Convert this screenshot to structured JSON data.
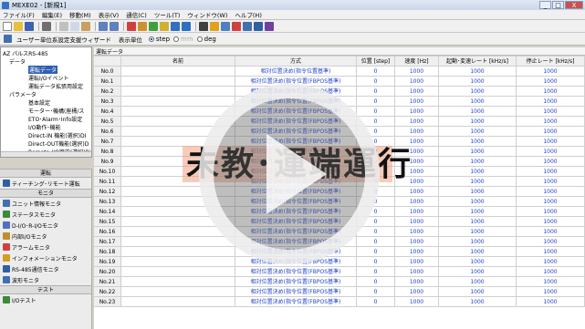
{
  "window": {
    "title": "MEXE02 - [新規1]",
    "min": "_",
    "max": "□",
    "close": "X"
  },
  "menu": [
    "ファイル(F)",
    "編集(E)",
    "移動(M)",
    "表示(V)",
    "通信(C)",
    "ツール(T)",
    "ウィンドウ(W)",
    "ヘルプ(H)"
  ],
  "subbar": {
    "wizard_label": "ユーザー単位系設定支援ウィザード",
    "unit_label": "表示単位",
    "units": [
      "step",
      "mm",
      "deg"
    ]
  },
  "tree": {
    "root": "AZ パルスRS-485",
    "data_group": "データ",
    "data_items": [
      "運転データ",
      "運転I/Oイベント",
      "運転データ拡張用設定"
    ],
    "param_group": "パラメータ",
    "param_items": [
      "基本設定",
      "モーター･機構(座標/ス",
      "ETO･Alarm･Info設定",
      "I/O動作･機能",
      "Direct-IN 機能(選択)DI",
      "Direct-OUT機能(選択)D",
      "Remote-I/O機能(選択)Ri"
    ]
  },
  "panel": {
    "operation_header": "運転",
    "teaching": "ティーチング･リモート運転",
    "monitor_header": "モニタ",
    "monitors": [
      "ユニット情報モニタ",
      "ステータスモニタ",
      "D-I/O･R-I/Oモニタ",
      "内部I/Oモニタ",
      "アラームモニタ",
      "インフォメーションモニタ",
      "RS-485通信モニタ",
      "波形モニタ"
    ],
    "test_header": "テスト",
    "io_test": "I/Oテスト"
  },
  "grid": {
    "tab": "運転データ",
    "headers": [
      "",
      "名前",
      "方式",
      "位置 [step]",
      "速度 [Hz]",
      "起動･変速レート [kHz/s]",
      "停止レート [kHz/s]"
    ],
    "method_text": "相対位置決め(指令位置基準)",
    "method_text_alt": "相対位置決め(FBPOS基準)",
    "rows": [
      {
        "no": "No.0",
        "method": "相対位置決め(指令位置基準)",
        "pos": "0",
        "speed": "1000",
        "accel": "1000",
        "decel": "1000"
      },
      {
        "no": "No.1",
        "method": "相対位置決め(指令位置(FBPOS基準)",
        "pos": "0",
        "speed": "1000",
        "accel": "1000",
        "decel": "1000"
      },
      {
        "no": "No.2",
        "method": "相対位置決め(指令位置(FBPOS基準)",
        "pos": "0",
        "speed": "1000",
        "accel": "1000",
        "decel": "1000"
      },
      {
        "no": "No.3",
        "method": "相対位置決め(指令位置(FBPOS基準)",
        "pos": "0",
        "speed": "1000",
        "accel": "1000",
        "decel": "1000"
      },
      {
        "no": "No.4",
        "method": "相対位置決め(指令位置(FBPOS基準)",
        "pos": "0",
        "speed": "1000",
        "accel": "1000",
        "decel": "1000"
      },
      {
        "no": "No.5",
        "method": "相対位置決め(指令位置(FBPOS基準)",
        "pos": "0",
        "speed": "1000",
        "accel": "1000",
        "decel": "1000"
      },
      {
        "no": "No.6",
        "method": "相対位置決め(指令位置(FBPOS基準)",
        "pos": "0",
        "speed": "1000",
        "accel": "1000",
        "decel": "1000"
      },
      {
        "no": "No.7",
        "method": "相対位置決め(指令位置(FBPOS基準)",
        "pos": "0",
        "speed": "1000",
        "accel": "1000",
        "decel": "1000"
      },
      {
        "no": "No.8",
        "method": "相対位置決め(指令位置(FBPOS基準)",
        "pos": "0",
        "speed": "1000",
        "accel": "1000",
        "decel": "1000"
      },
      {
        "no": "No.9",
        "method": "相対位置決め(指令位置(FBPOS基準)",
        "pos": "0",
        "speed": "1000",
        "accel": "1000",
        "decel": "1000"
      },
      {
        "no": "No.10",
        "method": "相対位置決め(指令位置(FBPOS基準)",
        "pos": "0",
        "speed": "1000",
        "accel": "1000",
        "decel": "1000"
      },
      {
        "no": "No.11",
        "method": "相対位置決め(指令位置(FBPOS基準)",
        "pos": "0",
        "speed": "1000",
        "accel": "1000",
        "decel": "1000"
      },
      {
        "no": "No.12",
        "method": "相対位置決め(指令位置(FBPOS基準)",
        "pos": "0",
        "speed": "1000",
        "accel": "1000",
        "decel": "1000"
      },
      {
        "no": "No.13",
        "method": "相対位置決め(指令位置(FBPOS基準)",
        "pos": "0",
        "speed": "1000",
        "accel": "1000",
        "decel": "1000"
      },
      {
        "no": "No.14",
        "method": "相対位置決め(指令位置(FBPOS基準)",
        "pos": "0",
        "speed": "1000",
        "accel": "1000",
        "decel": "1000"
      },
      {
        "no": "No.15",
        "method": "相対位置決め(指令位置(FBPOS基準)",
        "pos": "0",
        "speed": "1000",
        "accel": "1000",
        "decel": "1000"
      },
      {
        "no": "No.16",
        "method": "相対位置決め(指令位置(FBPOS基準)",
        "pos": "0",
        "speed": "1000",
        "accel": "1000",
        "decel": "1000"
      },
      {
        "no": "No.17",
        "method": "相対位置決め(指令位置(FBPOS基準)",
        "pos": "0",
        "speed": "1000",
        "accel": "1000",
        "decel": "1000"
      },
      {
        "no": "No.18",
        "method": "相対位置決め(指令位置(FBPOS基準)",
        "pos": "0",
        "speed": "1000",
        "accel": "1000",
        "decel": "1000"
      },
      {
        "no": "No.19",
        "method": "相対位置決め(指令位置(FBPOS基準)",
        "pos": "0",
        "speed": "1000",
        "accel": "1000",
        "decel": "1000"
      },
      {
        "no": "No.20",
        "method": "相対位置決め(指令位置(FBPOS基準)",
        "pos": "0",
        "speed": "1000",
        "accel": "1000",
        "decel": "1000"
      },
      {
        "no": "No.21",
        "method": "相対位置決め(指令位置(FBPOS基準)",
        "pos": "0",
        "speed": "1000",
        "accel": "1000",
        "decel": "1000"
      },
      {
        "no": "No.22",
        "method": "相対位置決め(指令位置(FBPOS基準)",
        "pos": "0",
        "speed": "1000",
        "accel": "1000",
        "decel": "1000"
      },
      {
        "no": "No.23",
        "method": "相対位置決め(指令位置(FBPOS基準)",
        "pos": "0",
        "speed": "1000",
        "accel": "1000",
        "decel": "1000"
      }
    ]
  },
  "overlay": {
    "banner": "未教･運端運行"
  },
  "colors": {
    "accent": "#2244c8",
    "banner": "#f0a082",
    "selection": "#2f5fb3"
  }
}
